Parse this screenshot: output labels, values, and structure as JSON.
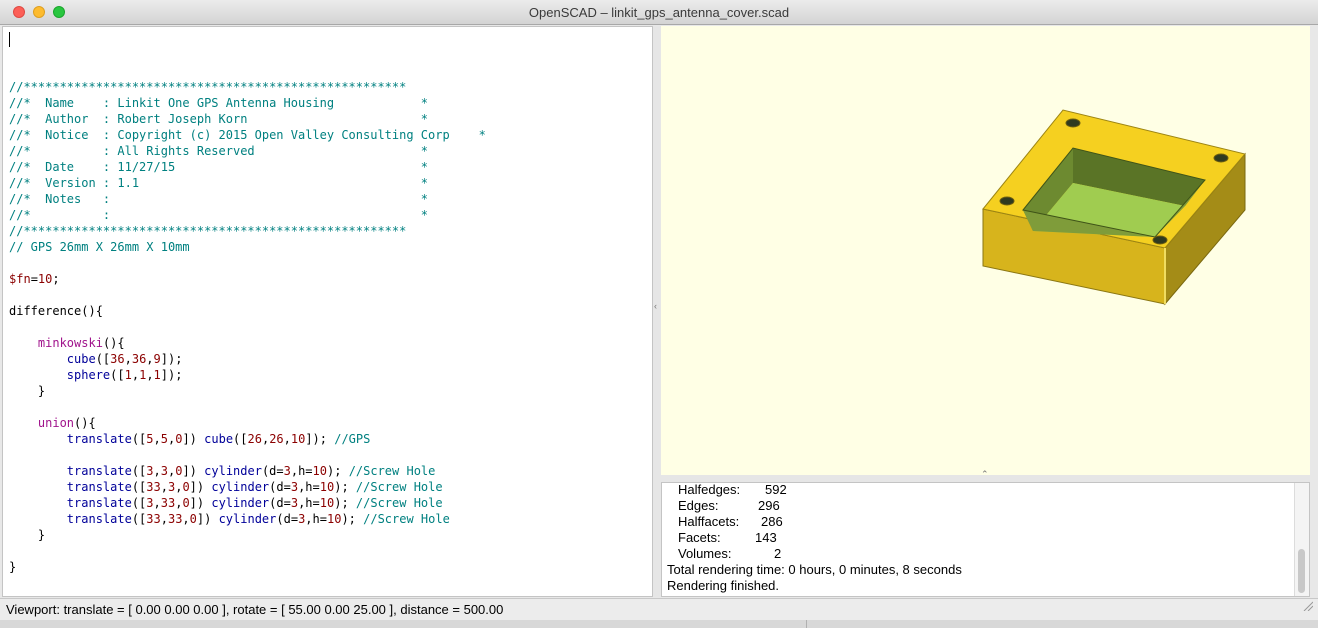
{
  "window": {
    "title": "OpenSCAD – linkit_gps_antenna_cover.scad"
  },
  "editor": {
    "lines": [
      [],
      [
        {
          "t": "//*****************************************************",
          "c": "c"
        }
      ],
      [
        {
          "t": "//*  Name    : Linkit One GPS Antenna Housing            *",
          "c": "c"
        }
      ],
      [
        {
          "t": "//*  Author  : Robert Joseph Korn                        *",
          "c": "c"
        }
      ],
      [
        {
          "t": "//*  Notice  : Copyright (c) 2015 Open Valley Consulting Corp    *",
          "c": "c"
        }
      ],
      [
        {
          "t": "//*          : All Rights Reserved                       *",
          "c": "c"
        }
      ],
      [
        {
          "t": "//*  Date    : 11/27/15                                  *",
          "c": "c"
        }
      ],
      [
        {
          "t": "//*  Version : 1.1                                       *",
          "c": "c"
        }
      ],
      [
        {
          "t": "//*  Notes   :                                           *",
          "c": "c"
        }
      ],
      [
        {
          "t": "//*          :                                           *",
          "c": "c"
        }
      ],
      [
        {
          "t": "//*****************************************************",
          "c": "c"
        }
      ],
      [
        {
          "t": "// GPS 26mm X 26mm X 10mm",
          "c": "c"
        }
      ],
      [],
      [
        {
          "t": "$fn",
          "c": "v"
        },
        {
          "t": "=",
          "c": "p"
        },
        {
          "t": "10",
          "c": "n"
        },
        {
          "t": ";",
          "c": "p"
        }
      ],
      [],
      [
        {
          "t": "difference",
          "c": "kw"
        },
        {
          "t": "(){",
          "c": "p"
        }
      ],
      [],
      [
        {
          "t": "    ",
          "c": "p"
        },
        {
          "t": "minkowski",
          "c": "k"
        },
        {
          "t": "(){",
          "c": "p"
        }
      ],
      [
        {
          "t": "        ",
          "c": "p"
        },
        {
          "t": "cube",
          "c": "f"
        },
        {
          "t": "([",
          "c": "p"
        },
        {
          "t": "36",
          "c": "n"
        },
        {
          "t": ",",
          "c": "p"
        },
        {
          "t": "36",
          "c": "n"
        },
        {
          "t": ",",
          "c": "p"
        },
        {
          "t": "9",
          "c": "n"
        },
        {
          "t": "]);",
          "c": "p"
        }
      ],
      [
        {
          "t": "        ",
          "c": "p"
        },
        {
          "t": "sphere",
          "c": "f"
        },
        {
          "t": "([",
          "c": "p"
        },
        {
          "t": "1",
          "c": "n"
        },
        {
          "t": ",",
          "c": "p"
        },
        {
          "t": "1",
          "c": "n"
        },
        {
          "t": ",",
          "c": "p"
        },
        {
          "t": "1",
          "c": "n"
        },
        {
          "t": "]);",
          "c": "p"
        }
      ],
      [
        {
          "t": "    }",
          "c": "p"
        }
      ],
      [],
      [
        {
          "t": "    ",
          "c": "p"
        },
        {
          "t": "union",
          "c": "k"
        },
        {
          "t": "(){",
          "c": "p"
        }
      ],
      [
        {
          "t": "        ",
          "c": "p"
        },
        {
          "t": "translate",
          "c": "f"
        },
        {
          "t": "([",
          "c": "p"
        },
        {
          "t": "5",
          "c": "n"
        },
        {
          "t": ",",
          "c": "p"
        },
        {
          "t": "5",
          "c": "n"
        },
        {
          "t": ",",
          "c": "p"
        },
        {
          "t": "0",
          "c": "n"
        },
        {
          "t": "]) ",
          "c": "p"
        },
        {
          "t": "cube",
          "c": "f"
        },
        {
          "t": "([",
          "c": "p"
        },
        {
          "t": "26",
          "c": "n"
        },
        {
          "t": ",",
          "c": "p"
        },
        {
          "t": "26",
          "c": "n"
        },
        {
          "t": ",",
          "c": "p"
        },
        {
          "t": "10",
          "c": "n"
        },
        {
          "t": "]); ",
          "c": "p"
        },
        {
          "t": "//GPS",
          "c": "c"
        }
      ],
      [],
      [
        {
          "t": "        ",
          "c": "p"
        },
        {
          "t": "translate",
          "c": "f"
        },
        {
          "t": "([",
          "c": "p"
        },
        {
          "t": "3",
          "c": "n"
        },
        {
          "t": ",",
          "c": "p"
        },
        {
          "t": "3",
          "c": "n"
        },
        {
          "t": ",",
          "c": "p"
        },
        {
          "t": "0",
          "c": "n"
        },
        {
          "t": "]) ",
          "c": "p"
        },
        {
          "t": "cylinder",
          "c": "f"
        },
        {
          "t": "(d=",
          "c": "p"
        },
        {
          "t": "3",
          "c": "n"
        },
        {
          "t": ",h=",
          "c": "p"
        },
        {
          "t": "10",
          "c": "n"
        },
        {
          "t": "); ",
          "c": "p"
        },
        {
          "t": "//Screw Hole",
          "c": "c"
        }
      ],
      [
        {
          "t": "        ",
          "c": "p"
        },
        {
          "t": "translate",
          "c": "f"
        },
        {
          "t": "([",
          "c": "p"
        },
        {
          "t": "33",
          "c": "n"
        },
        {
          "t": ",",
          "c": "p"
        },
        {
          "t": "3",
          "c": "n"
        },
        {
          "t": ",",
          "c": "p"
        },
        {
          "t": "0",
          "c": "n"
        },
        {
          "t": "]) ",
          "c": "p"
        },
        {
          "t": "cylinder",
          "c": "f"
        },
        {
          "t": "(d=",
          "c": "p"
        },
        {
          "t": "3",
          "c": "n"
        },
        {
          "t": ",h=",
          "c": "p"
        },
        {
          "t": "10",
          "c": "n"
        },
        {
          "t": "); ",
          "c": "p"
        },
        {
          "t": "//Screw Hole",
          "c": "c"
        }
      ],
      [
        {
          "t": "        ",
          "c": "p"
        },
        {
          "t": "translate",
          "c": "f"
        },
        {
          "t": "([",
          "c": "p"
        },
        {
          "t": "3",
          "c": "n"
        },
        {
          "t": ",",
          "c": "p"
        },
        {
          "t": "33",
          "c": "n"
        },
        {
          "t": ",",
          "c": "p"
        },
        {
          "t": "0",
          "c": "n"
        },
        {
          "t": "]) ",
          "c": "p"
        },
        {
          "t": "cylinder",
          "c": "f"
        },
        {
          "t": "(d=",
          "c": "p"
        },
        {
          "t": "3",
          "c": "n"
        },
        {
          "t": ",h=",
          "c": "p"
        },
        {
          "t": "10",
          "c": "n"
        },
        {
          "t": "); ",
          "c": "p"
        },
        {
          "t": "//Screw Hole",
          "c": "c"
        }
      ],
      [
        {
          "t": "        ",
          "c": "p"
        },
        {
          "t": "translate",
          "c": "f"
        },
        {
          "t": "([",
          "c": "p"
        },
        {
          "t": "33",
          "c": "n"
        },
        {
          "t": ",",
          "c": "p"
        },
        {
          "t": "33",
          "c": "n"
        },
        {
          "t": ",",
          "c": "p"
        },
        {
          "t": "0",
          "c": "n"
        },
        {
          "t": "]) ",
          "c": "p"
        },
        {
          "t": "cylinder",
          "c": "f"
        },
        {
          "t": "(d=",
          "c": "p"
        },
        {
          "t": "3",
          "c": "n"
        },
        {
          "t": ",h=",
          "c": "p"
        },
        {
          "t": "10",
          "c": "n"
        },
        {
          "t": "); ",
          "c": "p"
        },
        {
          "t": "//Screw Hole",
          "c": "c"
        }
      ],
      [
        {
          "t": "    }",
          "c": "p"
        }
      ],
      [],
      [
        {
          "t": "}",
          "c": "p"
        }
      ]
    ]
  },
  "console": {
    "stats": [
      {
        "label": "Halfedges:",
        "value": "592"
      },
      {
        "label": "Edges:",
        "value": "296"
      },
      {
        "label": "Halffacets:",
        "value": "286"
      },
      {
        "label": "Facets:",
        "value": "143"
      },
      {
        "label": "Volumes:",
        "value": "2"
      }
    ],
    "render_time": "Total rendering time: 0 hours, 0 minutes, 8 seconds",
    "finished": "Rendering finished."
  },
  "statusbar": {
    "viewport": "Viewport: translate = [ 0.00 0.00 0.00 ], rotate = [ 55.00 0.00 25.00 ], distance = 500.00"
  },
  "colors": {
    "viewport_bg": "#ffffe5",
    "model_top": "#f5d020",
    "model_side_left": "#d7b41c",
    "model_side_right": "#a48c17",
    "cavity_wall": "#64802c",
    "cavity_floor": "#a0cc50",
    "comment": "#008080",
    "number": "#8b0000"
  },
  "icons": [
    "close-icon",
    "minimize-icon",
    "zoom-icon",
    "resize-grip-icon"
  ]
}
